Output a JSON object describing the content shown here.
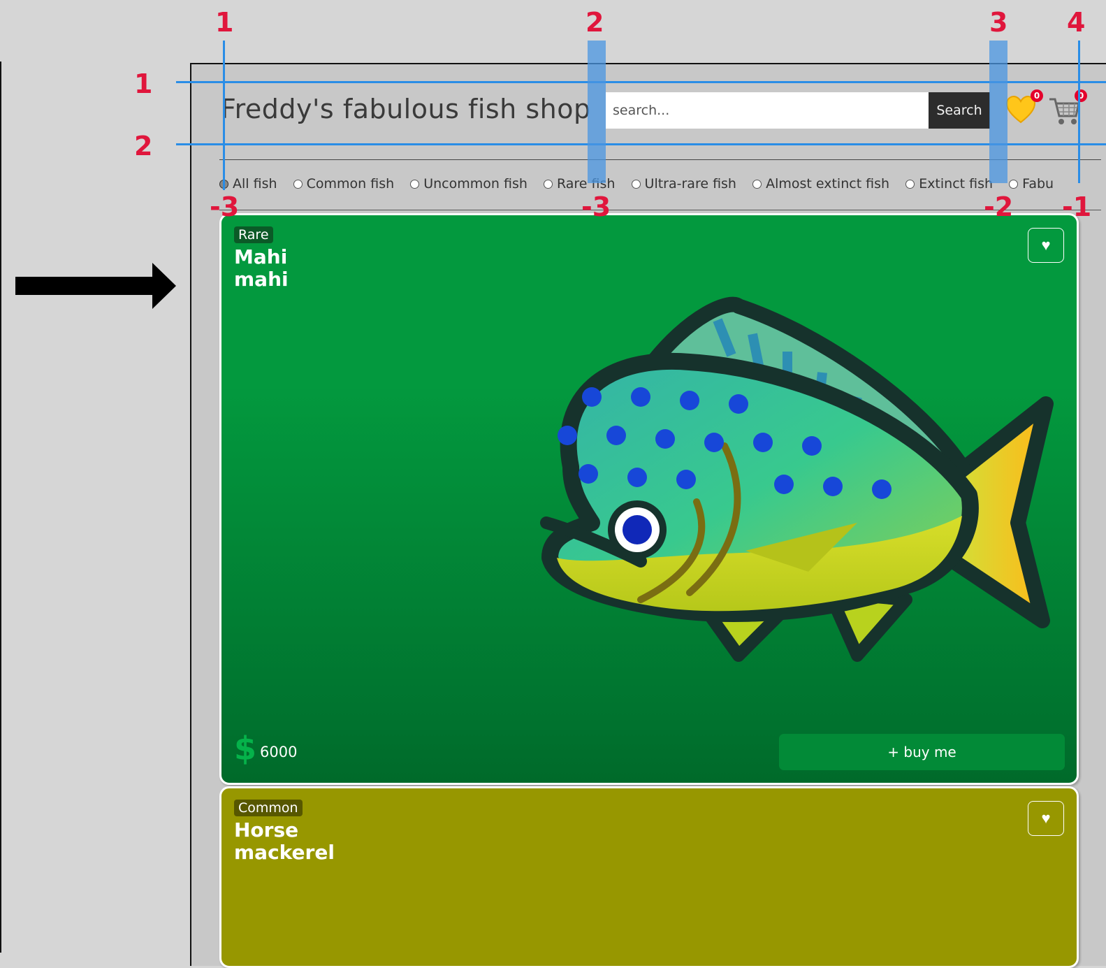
{
  "header": {
    "title": "Freddy's fabulous fish shop",
    "search_placeholder": "search...",
    "search_button": "Search",
    "favorites_count": "0",
    "cart_count": "0"
  },
  "filters": [
    {
      "label": "All fish",
      "selected": true
    },
    {
      "label": "Common fish",
      "selected": false
    },
    {
      "label": "Uncommon fish",
      "selected": false
    },
    {
      "label": "Rare fish",
      "selected": false
    },
    {
      "label": "Ultra-rare fish",
      "selected": false
    },
    {
      "label": "Almost extinct fish",
      "selected": false
    },
    {
      "label": "Extinct fish",
      "selected": false
    },
    {
      "label": "Fabu",
      "selected": false
    }
  ],
  "cards": [
    {
      "rarity": "Rare",
      "name": "Mahi mahi",
      "price_symbol": "$",
      "price": "6000",
      "buy_label": "+ buy me",
      "color": "#03993e"
    },
    {
      "rarity": "Common",
      "name": "Horse mackerel",
      "color": "#979700"
    }
  ],
  "annotations": {
    "top_markers": [
      "1",
      "2",
      "3",
      "4"
    ],
    "bottom_markers": [
      "-3",
      "-3",
      "-2",
      "-1"
    ],
    "row_markers": [
      "1",
      "2"
    ],
    "line_color": "#2a8de6",
    "marker_color": "#e0163c"
  }
}
